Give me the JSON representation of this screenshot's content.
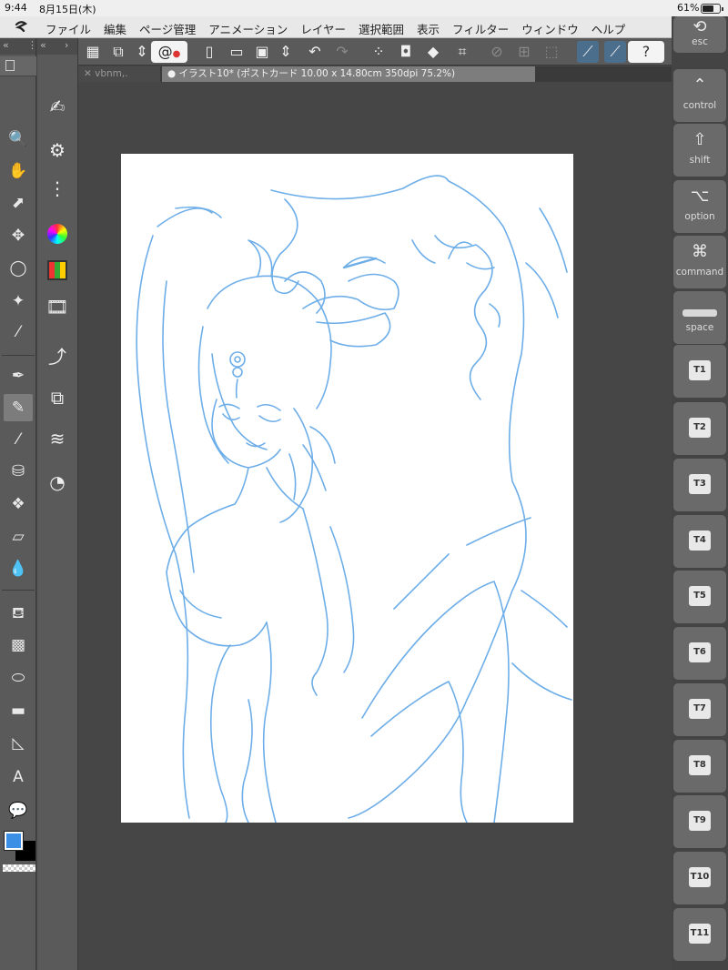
{
  "status_bar": {
    "time": "9:44",
    "date": "8月15日(木)",
    "battery_pct": "61%",
    "battery_level": 0.61
  },
  "menu_bar": {
    "logo_icon": "clip-studio-logo-icon",
    "items": [
      "ファイル",
      "編集",
      "ページ管理",
      "アニメーション",
      "レイヤー",
      "選択範囲",
      "表示",
      "フィルター",
      "ウィンドウ",
      "ヘルプ"
    ]
  },
  "command_bar": {
    "icons": [
      "grid-icon",
      "clip-studio-icon",
      "up-down-arrows-icon",
      "clip-spiral-icon",
      "new-file-icon",
      "open-folder-icon",
      "save-icon",
      "up-down-arrows-icon",
      "undo-icon",
      "redo-icon",
      "transform-points-icon",
      "layer-clear-icon",
      "fill-icon",
      "free-transform-icon",
      "clear-outside-icon",
      "invert-selection-icon",
      "selection-border-icon",
      "ruler-snap-icon",
      "special-ruler-snap-icon",
      "grid-snap-icon",
      "help-icon"
    ]
  },
  "tool_palette": {
    "icons": [
      "zoom-icon",
      "hand-icon",
      "object-select-icon",
      "move-layer-icon",
      "lasso-icon",
      "auto-select-icon",
      "eyedropper-icon",
      "pen-icon",
      "pencil-icon",
      "brush-icon",
      "airbrush-icon",
      "decoration-icon",
      "eraser-icon",
      "blend-icon",
      "fill-bucket-icon",
      "gradient-icon",
      "figure-icon",
      "frame-border-icon",
      "ruler-icon",
      "text-icon",
      "balloon-icon",
      "correct-line-icon"
    ]
  },
  "sub_tool_palette": {
    "icons": [
      "sub-tool-list-icon",
      "tool-property-icon",
      "sub-tool-detail-icon",
      "color-wheel-icon",
      "color-set-icon",
      "animation-timeline-icon",
      "brush-size-icon",
      "layer-property-icon",
      "layer-stack-icon",
      "navigator-search-icon"
    ]
  },
  "colors": {
    "main": "#3b8fe4",
    "sub": "#000000"
  },
  "tabs": [
    {
      "label": "vbnm,.",
      "active": false
    },
    {
      "label": "イラスト10* (ポストカード 10.00 x 14.80cm 350dpi 75.2%)",
      "active": true
    }
  ],
  "sketch": {
    "stroke_color": "#5fa6e6",
    "bg_color": "#ffffff"
  },
  "edge_keys": [
    {
      "label": "esc",
      "icon": "esc-icon"
    },
    {
      "label": "control",
      "icon": "chevron-up-icon"
    },
    {
      "label": "shift",
      "icon": "shift-arrow-icon"
    },
    {
      "label": "option",
      "icon": "option-key-icon"
    },
    {
      "label": "command",
      "icon": "command-key-icon"
    },
    {
      "label": "space",
      "icon": "space-bar-icon"
    },
    {
      "label": "T1"
    },
    {
      "label": "T2"
    },
    {
      "label": "T3"
    },
    {
      "label": "T4"
    },
    {
      "label": "T5"
    },
    {
      "label": "T6"
    },
    {
      "label": "T7"
    },
    {
      "label": "T8"
    },
    {
      "label": "T9"
    },
    {
      "label": "T10"
    },
    {
      "label": "T11"
    }
  ]
}
